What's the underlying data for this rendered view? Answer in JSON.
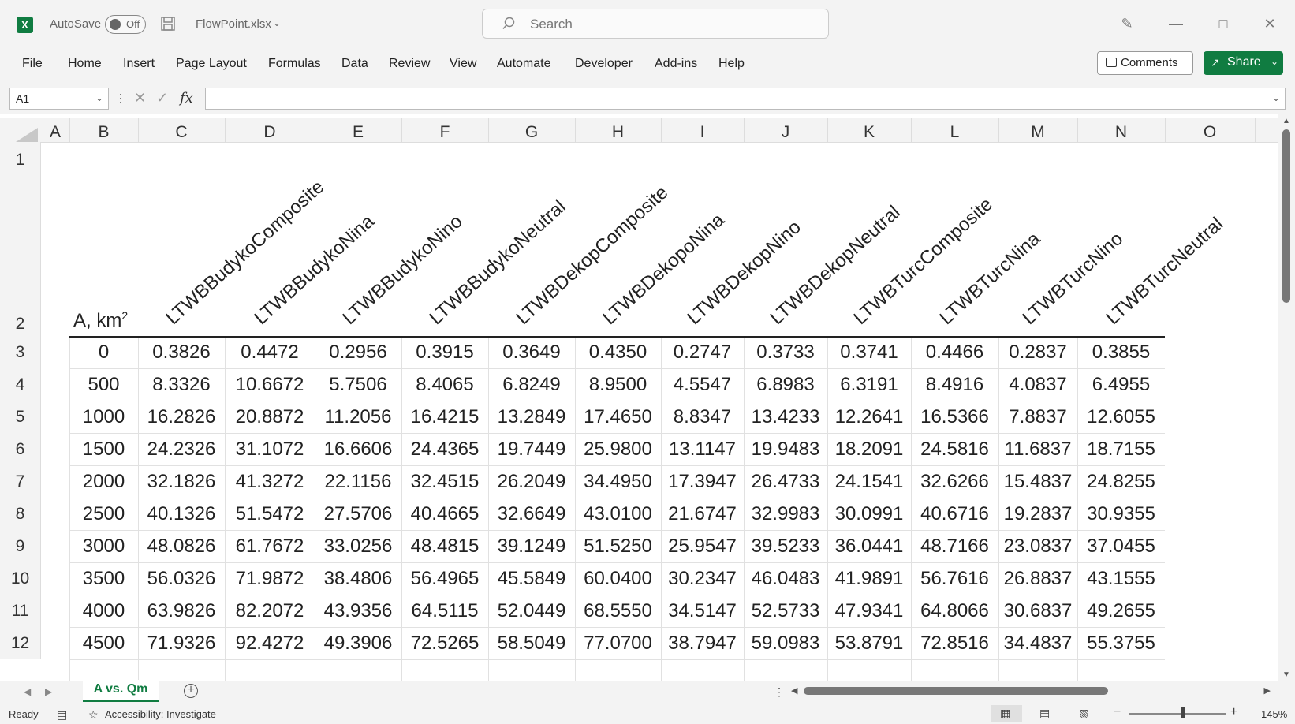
{
  "titlebar": {
    "app_icon": "X",
    "autosave_label": "AutoSave",
    "autosave_state": "Off",
    "filename": "FlowPoint.xlsx",
    "search_placeholder": "Search"
  },
  "ribbon": {
    "tabs": [
      "File",
      "Home",
      "Insert",
      "Page Layout",
      "Formulas",
      "Data",
      "Review",
      "View",
      "Automate",
      "Developer",
      "Add-ins",
      "Help"
    ],
    "comments_label": "Comments",
    "share_label": "Share"
  },
  "formula_bar": {
    "name_box": "A1",
    "fx_label": "fx",
    "formula": ""
  },
  "grid": {
    "columns": [
      "A",
      "B",
      "C",
      "D",
      "E",
      "F",
      "G",
      "H",
      "I",
      "J",
      "K",
      "L",
      "M",
      "N",
      "O"
    ],
    "rows": [
      "1",
      "2",
      "3",
      "4",
      "5",
      "6",
      "7",
      "8",
      "9",
      "10",
      "11",
      "12"
    ],
    "corner_label_A": "A, km",
    "corner_label_sup": "2",
    "series_headers": [
      "LTWBBudykoComposite",
      "LTWBBudykoNina",
      "LTWBBudykoNino",
      "LTWBBudykoNeutral",
      "LTWBDekopComposite",
      "LTWBDekopoNina",
      "LTWBDekopNino",
      "LTWBDekopNeutral",
      "LTWBTurcComposite",
      "LTWBTurcNina",
      "LTWBTurcNino",
      "LTWBTurcNeutral"
    ],
    "data_rows": [
      [
        "0",
        "0.3826",
        "0.4472",
        "0.2956",
        "0.3915",
        "0.3649",
        "0.4350",
        "0.2747",
        "0.3733",
        "0.3741",
        "0.4466",
        "0.2837",
        "0.3855"
      ],
      [
        "500",
        "8.3326",
        "10.6672",
        "5.7506",
        "8.4065",
        "6.8249",
        "8.9500",
        "4.5547",
        "6.8983",
        "6.3191",
        "8.4916",
        "4.0837",
        "6.4955"
      ],
      [
        "1000",
        "16.2826",
        "20.8872",
        "11.2056",
        "16.4215",
        "13.2849",
        "17.4650",
        "8.8347",
        "13.4233",
        "12.2641",
        "16.5366",
        "7.8837",
        "12.6055"
      ],
      [
        "1500",
        "24.2326",
        "31.1072",
        "16.6606",
        "24.4365",
        "19.7449",
        "25.9800",
        "13.1147",
        "19.9483",
        "18.2091",
        "24.5816",
        "11.6837",
        "18.7155"
      ],
      [
        "2000",
        "32.1826",
        "41.3272",
        "22.1156",
        "32.4515",
        "26.2049",
        "34.4950",
        "17.3947",
        "26.4733",
        "24.1541",
        "32.6266",
        "15.4837",
        "24.8255"
      ],
      [
        "2500",
        "40.1326",
        "51.5472",
        "27.5706",
        "40.4665",
        "32.6649",
        "43.0100",
        "21.6747",
        "32.9983",
        "30.0991",
        "40.6716",
        "19.2837",
        "30.9355"
      ],
      [
        "3000",
        "48.0826",
        "61.7672",
        "33.0256",
        "48.4815",
        "39.1249",
        "51.5250",
        "25.9547",
        "39.5233",
        "36.0441",
        "48.7166",
        "23.0837",
        "37.0455"
      ],
      [
        "3500",
        "56.0326",
        "71.9872",
        "38.4806",
        "56.4965",
        "45.5849",
        "60.0400",
        "30.2347",
        "46.0483",
        "41.9891",
        "56.7616",
        "26.8837",
        "43.1555"
      ],
      [
        "4000",
        "63.9826",
        "82.2072",
        "43.9356",
        "64.5115",
        "52.0449",
        "68.5550",
        "34.5147",
        "52.5733",
        "47.9341",
        "64.8066",
        "30.6837",
        "49.2655"
      ],
      [
        "4500",
        "71.9326",
        "92.4272",
        "49.3906",
        "72.5265",
        "58.5049",
        "77.0700",
        "38.7947",
        "59.0983",
        "53.8791",
        "72.8516",
        "34.4837",
        "55.3755"
      ]
    ]
  },
  "sheets": {
    "active": "A vs. Qm"
  },
  "status": {
    "ready": "Ready",
    "accessibility": "Accessibility: Investigate",
    "zoom": "145%"
  },
  "colors": {
    "accent": "#107c41"
  }
}
